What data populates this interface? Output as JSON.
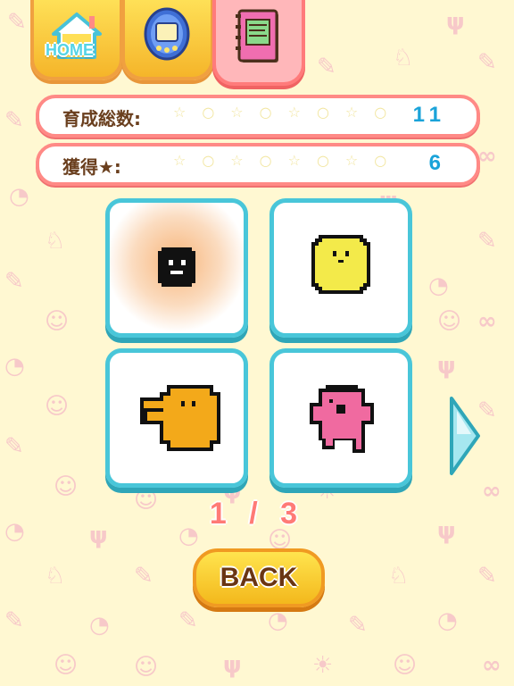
{
  "tabs": {
    "home_label": "HOME",
    "device_icon": "device-icon",
    "book_icon": "book-icon"
  },
  "stats": {
    "raised_label": "育成総数:",
    "raised_value": "11",
    "stars_label": "獲得★:",
    "stars_value": "6"
  },
  "characters": [
    {
      "icon": "black-blob-character",
      "color": "#111111"
    },
    {
      "icon": "yellow-round-character",
      "color": "#f3ea4a"
    },
    {
      "icon": "orange-character",
      "color": "#f3a91a"
    },
    {
      "icon": "pink-character",
      "color": "#f06aa0"
    }
  ],
  "pager": {
    "text": "1 / 3"
  },
  "back_button": {
    "label": "BACK"
  },
  "colors": {
    "accent_cyan": "#49c6d9",
    "bar_border": "#ff8a86",
    "button_yellow": "#ffe44e",
    "background": "#fff8d2"
  }
}
